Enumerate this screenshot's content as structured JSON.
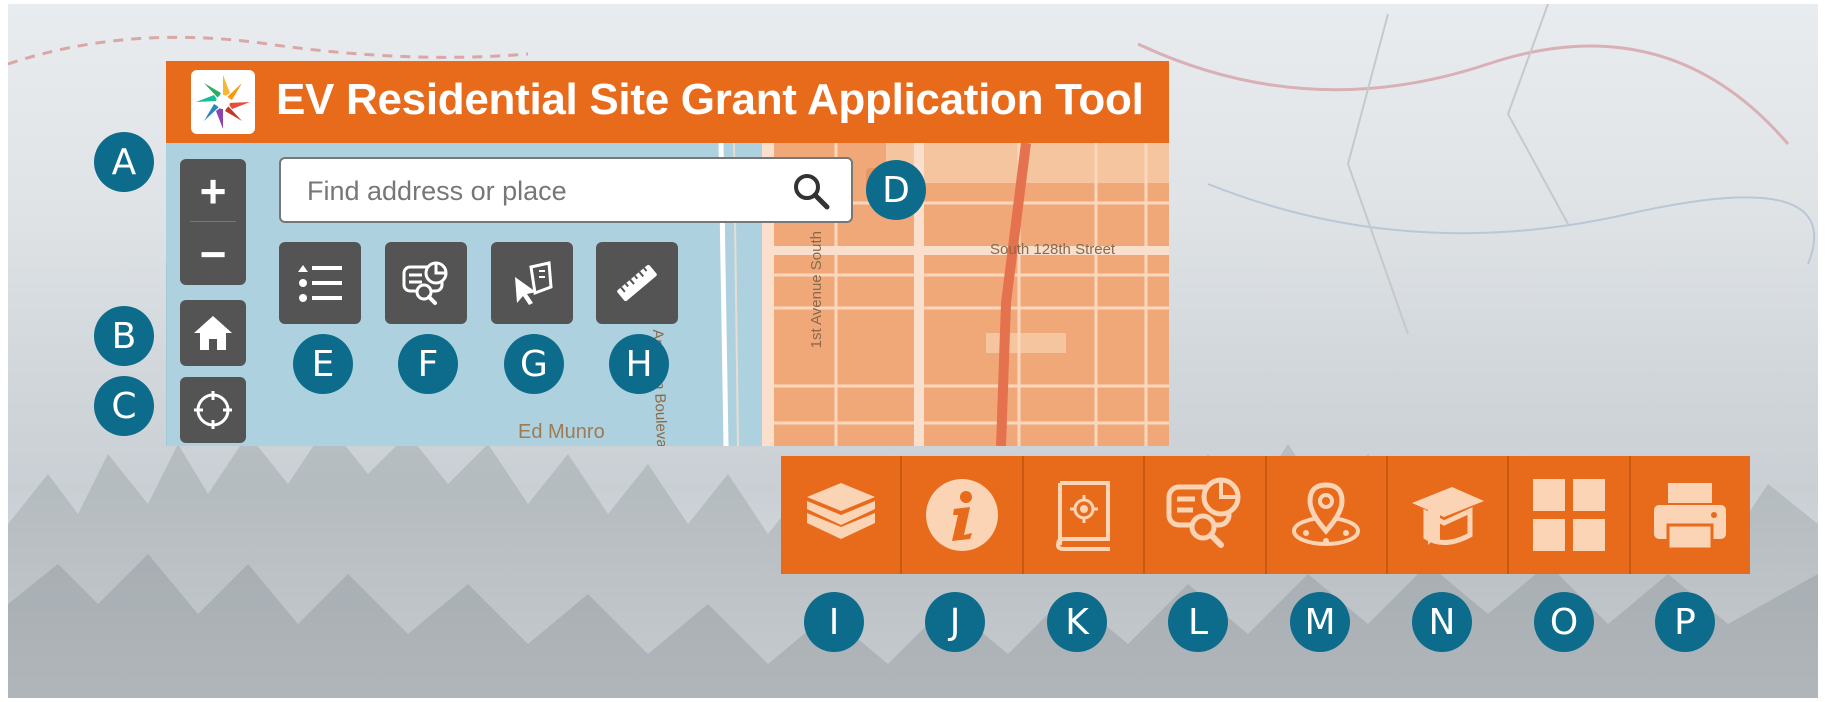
{
  "app": {
    "title": "EV Residential Site Grant Application Tool",
    "logo_icon": "starburst-logo"
  },
  "colors": {
    "header_orange": "#e86b1c",
    "control_gray": "#545454",
    "badge_blue": "#0d6c8c",
    "water_blue": "#add1de",
    "land_orange": "#f0a879"
  },
  "map_controls": {
    "zoom_in": "+",
    "zoom_out": "−",
    "home_icon": "home-icon",
    "locate_icon": "locate-icon"
  },
  "search": {
    "placeholder": "Find address or place",
    "icon": "search-icon"
  },
  "tools": [
    {
      "icon": "legend-list-icon"
    },
    {
      "icon": "query-report-icon"
    },
    {
      "icon": "select-icon"
    },
    {
      "icon": "measure-ruler-icon"
    }
  ],
  "map_labels": {
    "south_128th": "South 128th Street",
    "ambaum": "Ambaum Boulevard Sou",
    "first_ave": "1st Avenue South",
    "ed_munro": "Ed Munro"
  },
  "badges": {
    "A": "A",
    "B": "B",
    "C": "C",
    "D": "D",
    "E": "E",
    "F": "F",
    "G": "G",
    "H": "H",
    "I": "I",
    "J": "J",
    "K": "K",
    "L": "L",
    "M": "M",
    "N": "N",
    "O": "O",
    "P": "P"
  },
  "toolbar": [
    {
      "icon": "layers-icon"
    },
    {
      "icon": "info-icon"
    },
    {
      "icon": "book-settings-icon"
    },
    {
      "icon": "report-query-icon"
    },
    {
      "icon": "location-pin-icon"
    },
    {
      "icon": "learning-cap-icon"
    },
    {
      "icon": "grid-icon"
    },
    {
      "icon": "print-icon"
    }
  ]
}
